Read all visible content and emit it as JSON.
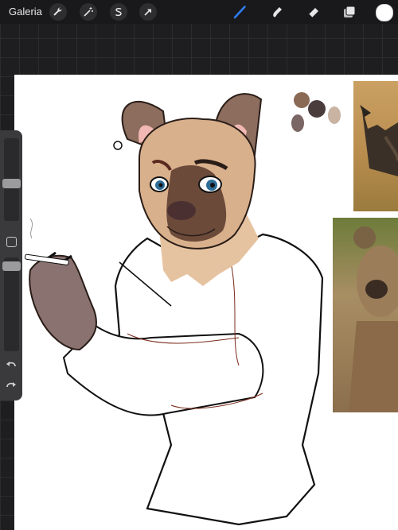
{
  "topbar": {
    "gallery_label": "Galeria",
    "left_tools": [
      "wrench-icon",
      "magic-wand-icon",
      "selection-s-icon",
      "transform-arrow-icon"
    ],
    "right_tools": [
      "brush-icon",
      "smudge-icon",
      "eraser-icon",
      "layers-icon"
    ],
    "active_tool": "brush-icon",
    "active_tool_color": "#2f7df6",
    "current_color": "#ffffff"
  },
  "sidebar": {
    "brush_size_level": 0.45,
    "opacity_level": 0.95
  },
  "palette": {
    "swatches": [
      "#8a6a55",
      "#4a3c3c",
      "#c9b3a3",
      "#7a6665"
    ]
  },
  "references": {
    "top_photo": "african-wild-dog-photo",
    "bottom_photo": "spotted-hyena-photo"
  }
}
